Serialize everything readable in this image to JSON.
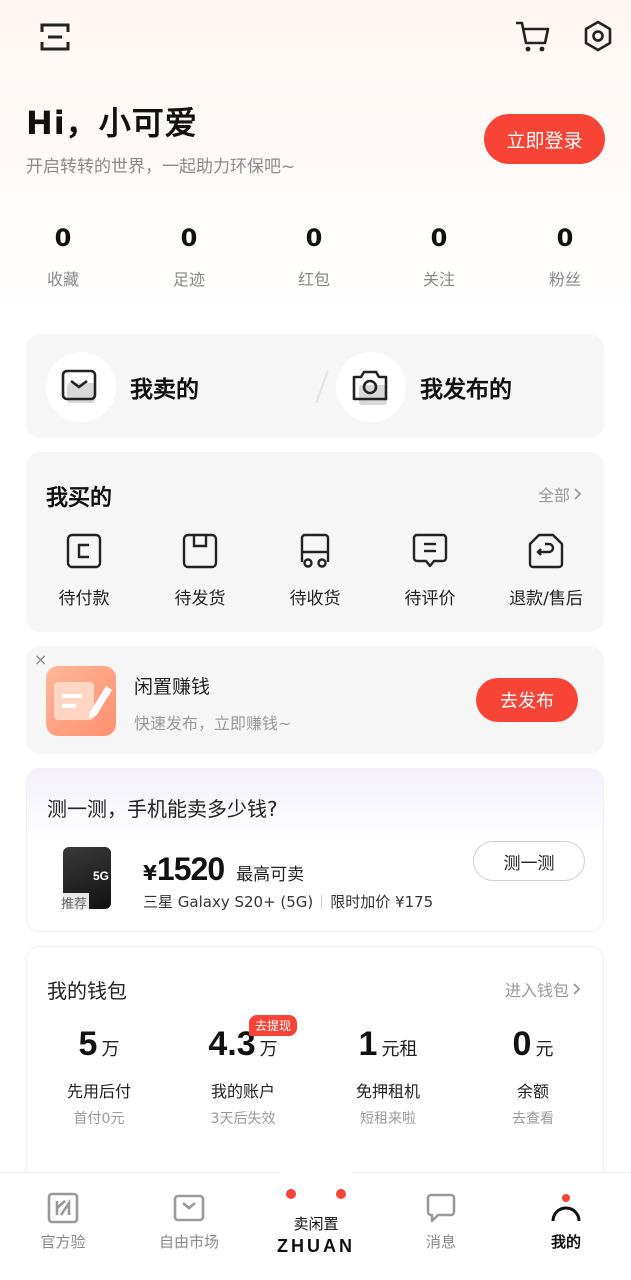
{
  "greeting": "Hi，小可爱",
  "subtitle": "开启转转的世界，一起助力环保吧~",
  "login_button": "立即登录",
  "stats": [
    {
      "value": "0",
      "label": "收藏"
    },
    {
      "value": "0",
      "label": "足迹"
    },
    {
      "value": "0",
      "label": "红包"
    },
    {
      "value": "0",
      "label": "关注"
    },
    {
      "value": "0",
      "label": "粉丝"
    }
  ],
  "sell": {
    "my_sold": "我卖的",
    "my_published": "我发布的"
  },
  "bought": {
    "title": "我买的",
    "more": "全部",
    "items": [
      {
        "label": "待付款",
        "icon": "wallet-icon"
      },
      {
        "label": "待发货",
        "icon": "box-icon"
      },
      {
        "label": "待收货",
        "icon": "truck-icon"
      },
      {
        "label": "待评价",
        "icon": "review-icon"
      },
      {
        "label": "退款/售后",
        "icon": "return-icon"
      }
    ]
  },
  "idle": {
    "close": "×",
    "title": "闲置赚钱",
    "subtitle": "快速发布，立即赚钱~",
    "button": "去发布"
  },
  "phone_eval": {
    "title": "测一测，手机能卖多少钱?",
    "tag": "推荐",
    "phone_badge": "5G",
    "currency": "¥",
    "price": "1520",
    "price_label": "最高可卖",
    "model": "三星 Galaxy S20+ (5G)",
    "bonus": "限时加价 ¥175",
    "button": "测一测"
  },
  "wallet": {
    "title": "我的钱包",
    "more": "进入钱包",
    "badge": "去提现",
    "items": [
      {
        "num": "5",
        "unit": "万",
        "label": "先用后付",
        "sub": "首付0元"
      },
      {
        "num": "4.3",
        "unit": "万",
        "label": "我的账户",
        "sub": "3天后失效"
      },
      {
        "num": "1",
        "unit": "元租",
        "label": "免押租机",
        "sub": "短租来啦"
      },
      {
        "num": "0",
        "unit": "元",
        "label": "余额",
        "sub": "去查看"
      }
    ]
  },
  "tabs": {
    "official": "官方验",
    "market": "自由市场",
    "sell": "卖闲置",
    "brand": "ZHUAN",
    "messages": "消息",
    "mine": "我的"
  },
  "colors": {
    "accent": "#f84337",
    "bg_card": "#f6f6f6"
  }
}
